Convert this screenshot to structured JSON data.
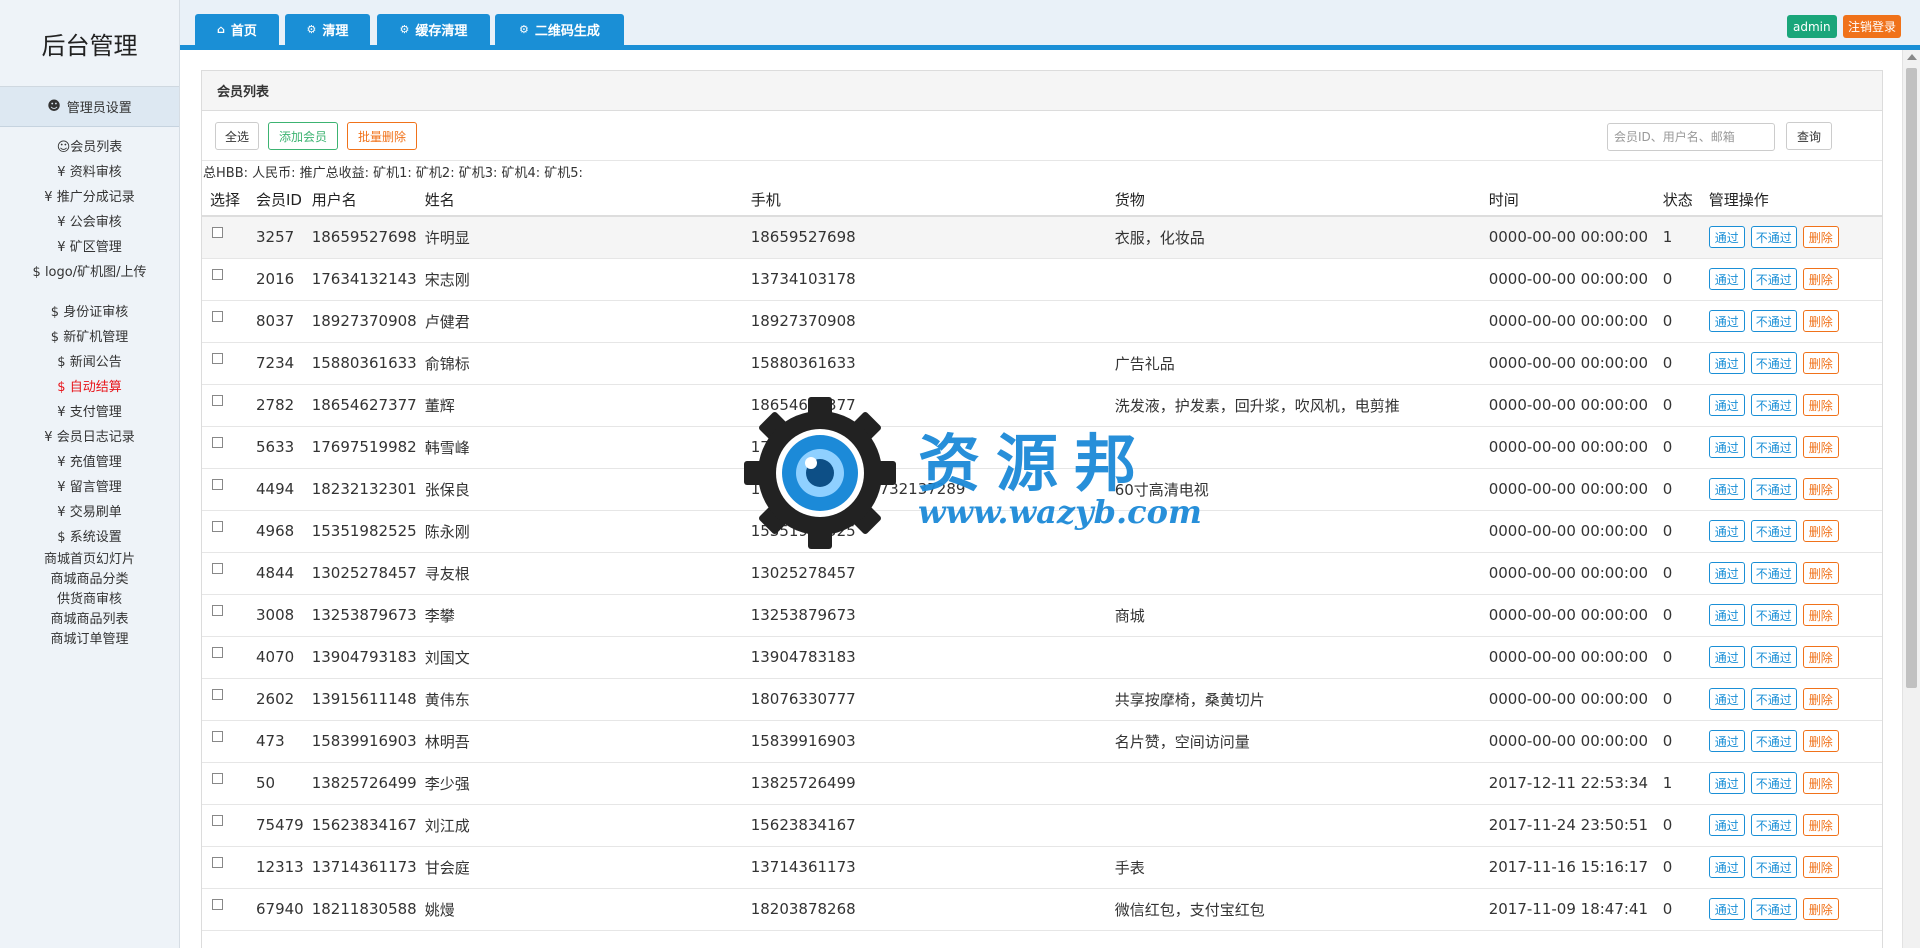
{
  "app": {
    "title": "后台管理"
  },
  "sidebar": {
    "header": "管理员设置",
    "items": [
      {
        "label": "会员列表",
        "prefix": "👤",
        "active": false
      },
      {
        "label": "资料审核",
        "prefix": "¥",
        "active": false
      },
      {
        "label": "推广分成记录",
        "prefix": "¥",
        "active": false
      },
      {
        "label": "公会审核",
        "prefix": "¥",
        "active": false
      },
      {
        "label": "矿区管理",
        "prefix": "¥",
        "active": false
      },
      {
        "label": "logo/矿机图/上传",
        "prefix": "$",
        "active": false
      },
      {
        "label": "身份证审核",
        "prefix": "$",
        "active": false
      },
      {
        "label": "新矿机管理",
        "prefix": "$",
        "active": false
      },
      {
        "label": "新闻公告",
        "prefix": "$",
        "active": false
      },
      {
        "label": "自动结算",
        "prefix": "$",
        "active": true
      },
      {
        "label": "支付管理",
        "prefix": "¥",
        "active": false
      },
      {
        "label": "会员日志记录",
        "prefix": "¥",
        "active": false
      },
      {
        "label": "充值管理",
        "prefix": "¥",
        "active": false
      },
      {
        "label": "留言管理",
        "prefix": "¥",
        "active": false
      },
      {
        "label": "交易刷单",
        "prefix": "¥",
        "active": false
      },
      {
        "label": "系统设置",
        "prefix": "$",
        "active": false
      },
      {
        "label": "商城首页幻灯片",
        "prefix": "",
        "active": false
      },
      {
        "label": "商城商品分类",
        "prefix": "",
        "active": false
      },
      {
        "label": "供货商审核",
        "prefix": "",
        "active": false
      },
      {
        "label": "商城商品列表",
        "prefix": "",
        "active": false
      },
      {
        "label": "商城订单管理",
        "prefix": "",
        "active": false
      }
    ]
  },
  "topbar": {
    "tabs": [
      {
        "label": "首页",
        "icon": "home-icon"
      },
      {
        "label": "清理",
        "icon": "gears-icon"
      },
      {
        "label": "缓存清理",
        "icon": "gears-icon"
      },
      {
        "label": "二维码生成",
        "icon": "gears-icon"
      }
    ],
    "user": "admin",
    "logout": "注销登录"
  },
  "panel": {
    "title": "会员列表",
    "buttons": {
      "select_all": "全选",
      "add_member": "添加会员",
      "batch_delete": "批量删除",
      "query": "查询"
    },
    "search_placeholder": "会员ID、用户名、邮箱",
    "summary": "总HBB: 人民币: 推广总收益: 矿机1:   矿机2:   矿机3:   矿机4:   矿机5:"
  },
  "table": {
    "headers": [
      "选择",
      "会员ID",
      "用户名",
      "姓名",
      "手机",
      "货物",
      "时间",
      "状态",
      "管理操作"
    ],
    "actions": {
      "pass": "通过",
      "fail": "不通过",
      "delete": "删除"
    },
    "rows": [
      {
        "id": "3257",
        "username": "18659527698",
        "name": "许明显",
        "phone": "18659527698",
        "goods": "衣服，化妆品",
        "time": "0000-00-00 00:00:00",
        "status": "1"
      },
      {
        "id": "2016",
        "username": "17634132143",
        "name": "宋志刚",
        "phone": "13734103178",
        "goods": "",
        "time": "0000-00-00 00:00:00",
        "status": "0"
      },
      {
        "id": "8037",
        "username": "18927370908",
        "name": "卢健君",
        "phone": "18927370908",
        "goods": "",
        "time": "0000-00-00 00:00:00",
        "status": "0"
      },
      {
        "id": "7234",
        "username": "15880361633",
        "name": "俞锦标",
        "phone": "15880361633",
        "goods": "广告礼品",
        "time": "0000-00-00 00:00:00",
        "status": "0"
      },
      {
        "id": "2782",
        "username": "18654627377",
        "name": "董辉",
        "phone": "18654627377",
        "goods": "洗发液，护发素，回升浆，吹风机，电剪推",
        "time": "0000-00-00 00:00:00",
        "status": "0"
      },
      {
        "id": "5633",
        "username": "17697519982",
        "name": "韩雪峰",
        "phone": "17697519982",
        "goods": "",
        "time": "0000-00-00 00:00:00",
        "status": "0"
      },
      {
        "id": "4494",
        "username": "18232132301",
        "name": "张保良",
        "phone": "18232132301 17732137289",
        "goods": "60寸高清电视",
        "time": "0000-00-00 00:00:00",
        "status": "0"
      },
      {
        "id": "4968",
        "username": "15351982525",
        "name": "陈永刚",
        "phone": "15351982525",
        "goods": "",
        "time": "0000-00-00 00:00:00",
        "status": "0"
      },
      {
        "id": "4844",
        "username": "13025278457",
        "name": "寻友根",
        "phone": "13025278457",
        "goods": "",
        "time": "0000-00-00 00:00:00",
        "status": "0"
      },
      {
        "id": "3008",
        "username": "13253879673",
        "name": "李攀",
        "phone": "13253879673",
        "goods": "商城",
        "time": "0000-00-00 00:00:00",
        "status": "0"
      },
      {
        "id": "4070",
        "username": "13904793183",
        "name": "刘国文",
        "phone": "13904783183",
        "goods": "",
        "time": "0000-00-00 00:00:00",
        "status": "0"
      },
      {
        "id": "2602",
        "username": "13915611148",
        "name": "黄伟东",
        "phone": "18076330777",
        "goods": "共享按摩椅，桑黄切片",
        "time": "0000-00-00 00:00:00",
        "status": "0"
      },
      {
        "id": "473",
        "username": "15839916903",
        "name": "林明吾",
        "phone": "15839916903",
        "goods": "名片赞，空间访问量",
        "time": "0000-00-00 00:00:00",
        "status": "0"
      },
      {
        "id": "50",
        "username": "13825726499",
        "name": "李少强",
        "phone": "13825726499",
        "goods": "",
        "time": "2017-12-11 22:53:34",
        "status": "1"
      },
      {
        "id": "75479",
        "username": "15623834167",
        "name": "刘江成",
        "phone": "15623834167",
        "goods": "",
        "time": "2017-11-24 23:50:51",
        "status": "0"
      },
      {
        "id": "12313",
        "username": "13714361173",
        "name": "甘会庭",
        "phone": "13714361173",
        "goods": "手表",
        "time": "2017-11-16 15:16:17",
        "status": "0"
      },
      {
        "id": "67940",
        "username": "18211830588",
        "name": "姚熳",
        "phone": "18203878268",
        "goods": "微信红包，支付宝红包",
        "time": "2017-11-09 18:47:41",
        "status": "0"
      }
    ]
  },
  "watermark": {
    "text": "资源邦",
    "url": "www.wazyb.com"
  },
  "colors": {
    "primary": "#1a8fd6",
    "success": "#1aa67a",
    "warning": "#f0721a",
    "active_menu": "#e8141a"
  }
}
